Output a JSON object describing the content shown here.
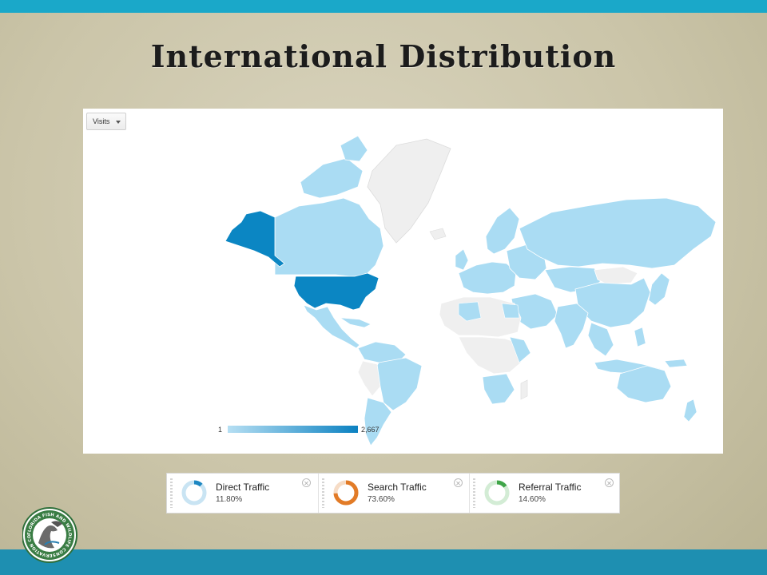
{
  "slide": {
    "title": "International Distribution"
  },
  "map": {
    "metric_selector": {
      "label": "Visits"
    },
    "legend": {
      "min": "1",
      "max": "2,667"
    },
    "colors": {
      "high": "#0b86c3",
      "medium": "#7fc6ea",
      "low": "#aadcf3",
      "no_data": "#efefef"
    }
  },
  "traffic_sources": [
    {
      "label": "Direct Traffic",
      "value": "11.80%",
      "percent": 11.8,
      "color": "#1d87c2",
      "track": "#c9e4f3"
    },
    {
      "label": "Search Traffic",
      "value": "73.60%",
      "percent": 73.6,
      "color": "#e27b27",
      "track": "#f6dcc6"
    },
    {
      "label": "Referral Traffic",
      "value": "14.60%",
      "percent": 14.6,
      "color": "#3fa548",
      "track": "#d3ecd5"
    }
  ],
  "logo": {
    "text": "FLORIDA FISH AND WILDLIFE CONSERVATION COMMISSION"
  }
}
